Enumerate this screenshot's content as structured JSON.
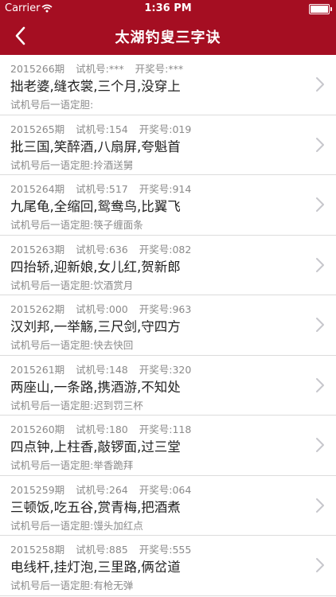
{
  "status_bar": {
    "carrier": "Carrier",
    "time": "1:36 PM"
  },
  "nav": {
    "title": "太湖钓叟三字诀"
  },
  "rows": [
    {
      "period": "2015266期",
      "trial": "试机号:***",
      "draw": "开奖号:***",
      "verse": "拙老婆,缝衣裳,三个月,没穿上",
      "hint": "试机号后一语定胆:"
    },
    {
      "period": "2015265期",
      "trial": "试机号:154",
      "draw": "开奖号:019",
      "verse": "批三国,笑醉酒,八扇屏,夸魁首",
      "hint": "试机号后一语定胆:拎酒送舅"
    },
    {
      "period": "2015264期",
      "trial": "试机号:517",
      "draw": "开奖号:914",
      "verse": "九尾龟,全缩回,鸳鸯鸟,比翼飞",
      "hint": "试机号后一语定胆:筷子缠面条"
    },
    {
      "period": "2015263期",
      "trial": "试机号:636",
      "draw": "开奖号:082",
      "verse": "四抬轿,迎新娘,女儿红,贺新郎",
      "hint": "试机号后一语定胆:饮酒赏月"
    },
    {
      "period": "2015262期",
      "trial": "试机号:000",
      "draw": "开奖号:963",
      "verse": "汉刘邦,一举觞,三尺剑,守四方",
      "hint": "试机号后一语定胆:快去快回"
    },
    {
      "period": "2015261期",
      "trial": "试机号:148",
      "draw": "开奖号:320",
      "verse": "两座山,一条路,携酒游,不知处",
      "hint": "试机号后一语定胆:迟到罚三杯"
    },
    {
      "period": "2015260期",
      "trial": "试机号:180",
      "draw": "开奖号:118",
      "verse": "四点钟,上柱香,敲锣面,过三堂",
      "hint": "试机号后一语定胆:举香跪拜"
    },
    {
      "period": "2015259期",
      "trial": "试机号:264",
      "draw": "开奖号:064",
      "verse": "三顿饭,吃五谷,赏青梅,把酒煮",
      "hint": "试机号后一语定胆:馒头加红点"
    },
    {
      "period": "2015258期",
      "trial": "试机号:885",
      "draw": "开奖号:555",
      "verse": "电线杆,挂灯泡,三里路,俩岔道",
      "hint": "试机号后一语定胆:有枪无弹"
    }
  ]
}
